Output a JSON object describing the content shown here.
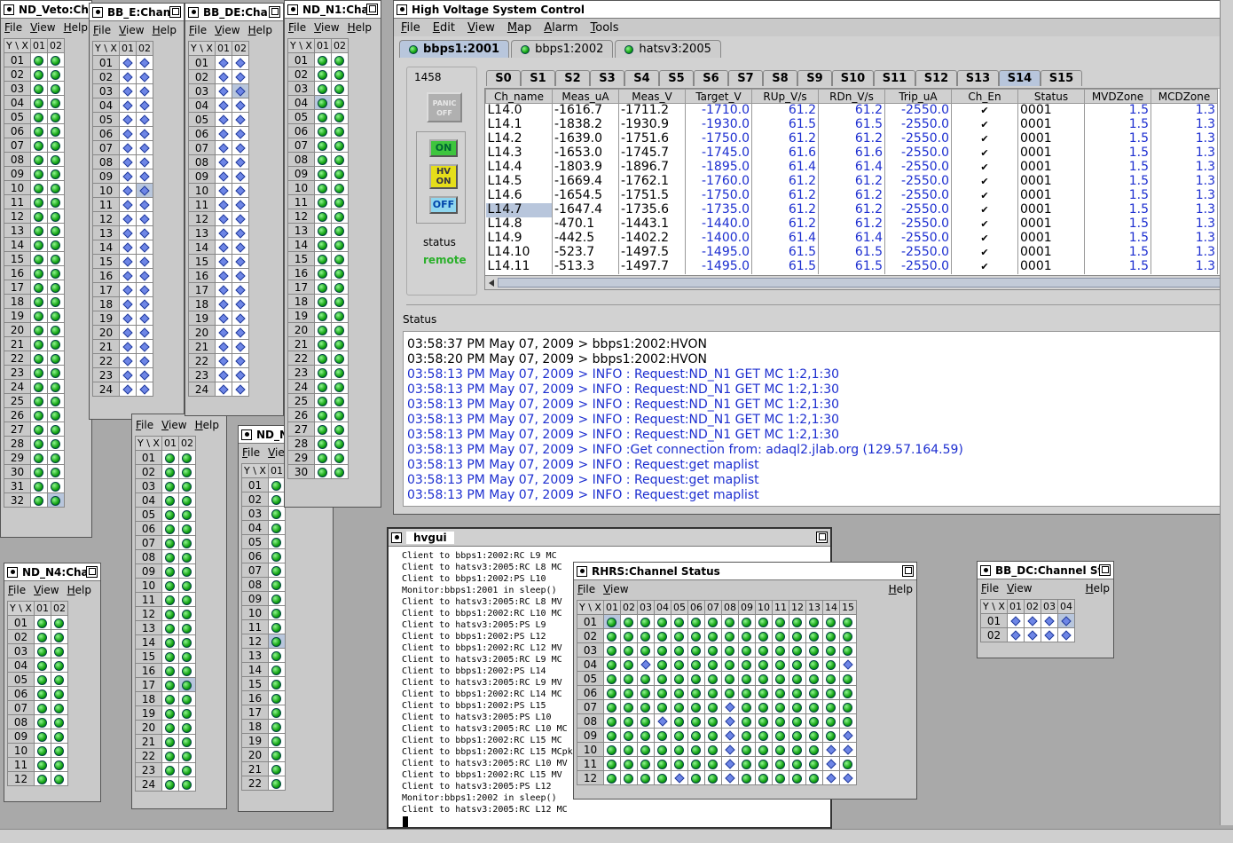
{
  "menus": {
    "file": "File",
    "view": "View",
    "help": "Help",
    "edit": "Edit",
    "map": "Map",
    "alarm": "Alarm",
    "tools": "Tools"
  },
  "yx": "Y \\ X",
  "veto": {
    "title": "ND_Veto:Ch",
    "cols": [
      "01",
      "02"
    ],
    "rows": [
      "01",
      "02",
      "03",
      "04",
      "05",
      "06",
      "07",
      "08",
      "09",
      "10",
      "11",
      "12",
      "13",
      "14",
      "15",
      "16",
      "17",
      "18",
      "19",
      "20",
      "21",
      "22",
      "23",
      "24",
      "25",
      "26",
      "27",
      "28",
      "29",
      "30",
      "31",
      "32"
    ]
  },
  "bbe": {
    "title": "BB_E:Chan",
    "cols": [
      "01",
      "02"
    ],
    "rows": [
      "01",
      "02",
      "03",
      "04",
      "05",
      "06",
      "07",
      "08",
      "09",
      "10",
      "11",
      "12",
      "13",
      "14",
      "15",
      "16",
      "17",
      "18",
      "19",
      "20",
      "21",
      "22",
      "23",
      "24"
    ]
  },
  "bbde": {
    "title": "BB_DE:Cha",
    "cols": [
      "01",
      "02"
    ],
    "rows": [
      "01",
      "02",
      "03",
      "04",
      "05",
      "06",
      "07",
      "08",
      "09",
      "10",
      "11",
      "12",
      "13",
      "14",
      "15",
      "16",
      "17",
      "18",
      "19",
      "20",
      "21",
      "22",
      "23",
      "24"
    ]
  },
  "n1": {
    "title": "ND_N1:Cha",
    "cols": [
      "01",
      "02"
    ],
    "rows": [
      "01",
      "02",
      "03",
      "04",
      "05",
      "06",
      "07",
      "08",
      "09",
      "10",
      "11",
      "12",
      "13",
      "14",
      "15",
      "16",
      "17",
      "18",
      "19",
      "20",
      "21",
      "22",
      "23",
      "24",
      "25",
      "26",
      "27",
      "28",
      "29",
      "30"
    ]
  },
  "n4": {
    "title": "ND_N4:Cha",
    "cols": [
      "01",
      "02"
    ],
    "rows": [
      "01",
      "02",
      "03",
      "04",
      "05",
      "06",
      "07",
      "08",
      "09",
      "10",
      "11",
      "12"
    ]
  },
  "mid1": {
    "cols": [
      "01",
      "02"
    ],
    "rows": [
      "01",
      "02",
      "03",
      "04",
      "05",
      "06",
      "07",
      "08",
      "09",
      "10",
      "11",
      "12",
      "13",
      "14",
      "15",
      "16",
      "17",
      "18",
      "19",
      "20",
      "21",
      "22",
      "23",
      "24"
    ]
  },
  "mid2": {
    "title": "ND_N",
    "cols": [
      "01"
    ],
    "rows": [
      "01",
      "02",
      "03",
      "04",
      "05",
      "06",
      "07",
      "08",
      "09",
      "10",
      "11",
      "12",
      "13",
      "14",
      "15",
      "16",
      "17",
      "18",
      "19",
      "20",
      "21",
      "22"
    ]
  },
  "hv": {
    "title": "High Voltage System Control",
    "tabs": [
      "bbps1:2001",
      "bbps1:2002",
      "hatsv3:2005"
    ],
    "count": "1458",
    "panic": "PANIC OFF",
    "on": "ON",
    "hvon": "HV ON",
    "off": "OFF",
    "status_label": "status",
    "status_value": "remote",
    "slots": [
      "S0",
      "S1",
      "S2",
      "S3",
      "S4",
      "S5",
      "S6",
      "S7",
      "S8",
      "S9",
      "S10",
      "S11",
      "S12",
      "S13",
      "S14",
      "S15"
    ],
    "active_slot": "S14",
    "headers": [
      "Ch_name",
      "Meas_uA",
      "Meas_V",
      "Target_V",
      "RUp_V/s",
      "RDn_V/s",
      "Trip_uA",
      "Ch_En",
      "Status",
      "MVDZone",
      "MCDZone"
    ],
    "rows": [
      [
        "L14.0",
        "-1616.7",
        "-1711.2",
        "-1710.0",
        "61.2",
        "61.2",
        "-2550.0",
        "✔",
        "0001",
        "1.5",
        "1.3"
      ],
      [
        "L14.1",
        "-1838.2",
        "-1930.9",
        "-1930.0",
        "61.5",
        "61.5",
        "-2550.0",
        "✔",
        "0001",
        "1.5",
        "1.3"
      ],
      [
        "L14.2",
        "-1639.0",
        "-1751.6",
        "-1750.0",
        "61.2",
        "61.2",
        "-2550.0",
        "✔",
        "0001",
        "1.5",
        "1.3"
      ],
      [
        "L14.3",
        "-1653.0",
        "-1745.7",
        "-1745.0",
        "61.6",
        "61.6",
        "-2550.0",
        "✔",
        "0001",
        "1.5",
        "1.3"
      ],
      [
        "L14.4",
        "-1803.9",
        "-1896.7",
        "-1895.0",
        "61.4",
        "61.4",
        "-2550.0",
        "✔",
        "0001",
        "1.5",
        "1.3"
      ],
      [
        "L14.5",
        "-1669.4",
        "-1762.1",
        "-1760.0",
        "61.2",
        "61.2",
        "-2550.0",
        "✔",
        "0001",
        "1.5",
        "1.3"
      ],
      [
        "L14.6",
        "-1654.5",
        "-1751.5",
        "-1750.0",
        "61.2",
        "61.2",
        "-2550.0",
        "✔",
        "0001",
        "1.5",
        "1.3"
      ],
      [
        "L14.7",
        "-1647.4",
        "-1735.6",
        "-1735.0",
        "61.2",
        "61.2",
        "-2550.0",
        "✔",
        "0001",
        "1.5",
        "1.3"
      ],
      [
        "L14.8",
        "-470.1",
        "-1443.1",
        "-1440.0",
        "61.2",
        "61.2",
        "-2550.0",
        "✔",
        "0001",
        "1.5",
        "1.3"
      ],
      [
        "L14.9",
        "-442.5",
        "-1402.2",
        "-1400.0",
        "61.4",
        "61.4",
        "-2550.0",
        "✔",
        "0001",
        "1.5",
        "1.3"
      ],
      [
        "L14.10",
        "-523.7",
        "-1497.5",
        "-1495.0",
        "61.5",
        "61.5",
        "-2550.0",
        "✔",
        "0001",
        "1.5",
        "1.3"
      ],
      [
        "L14.11",
        "-513.3",
        "-1497.7",
        "-1495.0",
        "61.5",
        "61.5",
        "-2550.0",
        "✔",
        "0001",
        "1.5",
        "1.3"
      ]
    ],
    "log_title": "Status",
    "log": [
      "03:58:37 PM May 07, 2009 > bbps1:2002:HVON",
      "03:58:20 PM May 07, 2009 > bbps1:2002:HVON",
      "03:58:13 PM May 07, 2009 > INFO : Request:ND_N1 GET MC 1:2,1:30",
      "03:58:13 PM May 07, 2009 > INFO : Request:ND_N1 GET MC 1:2,1:30",
      "03:58:13 PM May 07, 2009 > INFO : Request:ND_N1 GET MC 1:2,1:30",
      "03:58:13 PM May 07, 2009 > INFO : Request:ND_N1 GET MC 1:2,1:30",
      "03:58:13 PM May 07, 2009 > INFO : Request:ND_N1 GET MC 1:2,1:30",
      "03:58:13 PM May 07, 2009 > INFO :Get connection from: adaql2.jlab.org (129.57.164.59)",
      "03:58:13 PM May 07, 2009 > INFO : Request:get maplist",
      "03:58:13 PM May 07, 2009 > INFO : Request:get maplist",
      "03:58:13 PM May 07, 2009 > INFO : Request:get maplist"
    ]
  },
  "hvgui": {
    "title": "hvgui",
    "lines": [
      "Client to bbps1:2002:RC L9 MC",
      "Client to hatsv3:2005:RC L8 MC",
      "Client to bbps1:2002:PS L10",
      "Monitor:bbps1:2001 in sleep()",
      "Client to hatsv3:2005:RC L8 MV",
      "Client to bbps1:2002:RC L10 MC",
      "Client to hatsv3:2005:PS L9",
      "Client to bbps1:2002:PS L12",
      "Client to bbps1:2002:RC L12 MV",
      "Client to hatsv3:2005:RC L9 MC",
      "Client to bbps1:2002:PS L14",
      "Client to hatsv3:2005:RC L9 MV",
      "Client to bbps1:2002:RC L14 MC",
      "Client to bbps1:2002:PS L15",
      "Client to hatsv3:2005:PS L10",
      "Client to hatsv3:2005:RC L10 MC",
      "Client to bbps1:2002:RC L15 MC",
      "Client to bbps1:2002:RC L15 MCpk",
      "Client to hatsv3:2005:RC L10 MV",
      "Client to bbps1:2002:RC L15 MV",
      "Client to hatsv3:2005:PS L12",
      "Monitor:bbps1:2002 in sleep()",
      "Client to hatsv3:2005:RC L12 MC"
    ]
  },
  "rhrs": {
    "title": "RHRS:Channel Status",
    "cols": [
      "01",
      "02",
      "03",
      "04",
      "05",
      "06",
      "07",
      "08",
      "09",
      "10",
      "11",
      "12",
      "13",
      "14",
      "15"
    ],
    "rows": [
      "01",
      "02",
      "03",
      "04",
      "05",
      "06",
      "07",
      "08",
      "09",
      "10",
      "11",
      "12"
    ]
  },
  "bbdc": {
    "title": "BB_DC:Channel St",
    "cols": [
      "01",
      "02",
      "03",
      "04"
    ],
    "rows": [
      "01",
      "02"
    ]
  }
}
